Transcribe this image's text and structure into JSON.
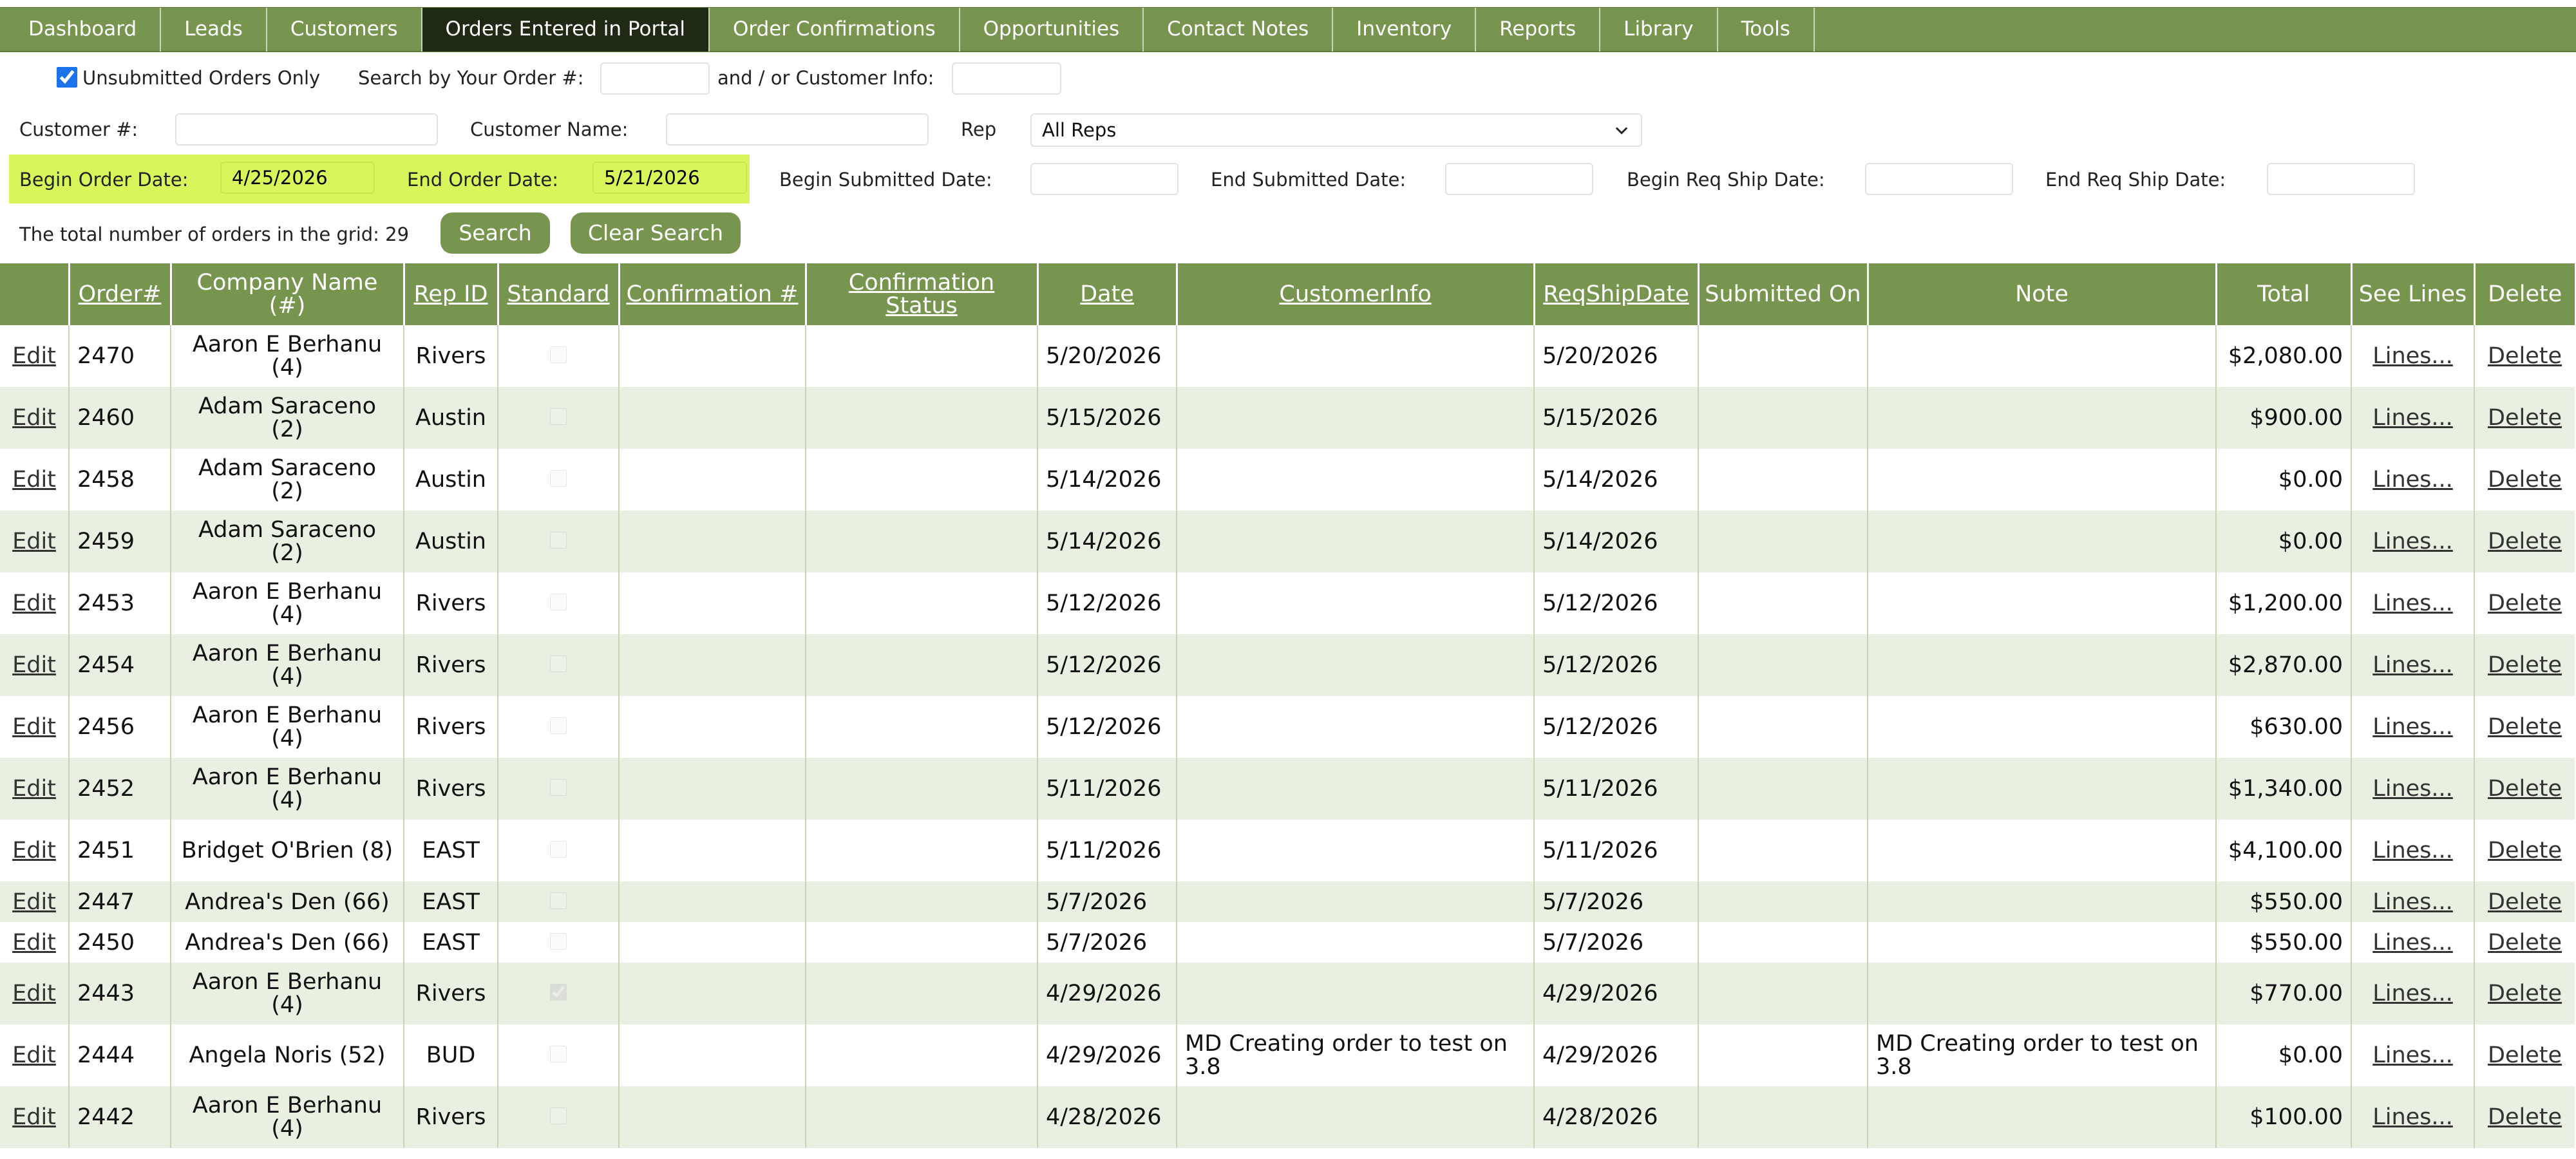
{
  "nav": {
    "tabs": [
      "Dashboard",
      "Leads",
      "Customers",
      "Orders Entered in Portal",
      "Order Confirmations",
      "Opportunities",
      "Contact Notes",
      "Inventory",
      "Reports",
      "Library",
      "Tools"
    ],
    "active_index": 3
  },
  "filters": {
    "unsubmitted_label": "Unsubmitted Orders Only",
    "unsubmitted_checked": true,
    "search_order_label": "Search by Your Order #:",
    "search_order_value": "",
    "customer_info_label": "and / or Customer Info:",
    "customer_info_value": "",
    "customer_num_label": "Customer #:",
    "customer_num_value": "",
    "customer_name_label": "Customer Name:",
    "customer_name_value": "",
    "rep_label": "Rep",
    "rep_selected": "All Reps",
    "begin_order_label": "Begin Order Date:",
    "begin_order_value": "4/25/2026",
    "end_order_label": "End Order Date:",
    "end_order_value": "5/21/2026",
    "begin_submitted_label": "Begin Submitted Date:",
    "begin_submitted_value": "",
    "end_submitted_label": "End Submitted Date:",
    "end_submitted_value": "",
    "begin_ship_label": "Begin Req Ship Date:",
    "begin_ship_value": "",
    "end_ship_label": "End Req Ship Date:",
    "end_ship_value": "",
    "total_label": "The total number of orders in the grid: 29",
    "search_button": "Search",
    "clear_button": "Clear Search"
  },
  "grid": {
    "columns": [
      "",
      "Order#",
      "Company Name (#)",
      "Rep ID",
      "Standard",
      "Confirmation #",
      "Confirmation Status",
      "Date",
      "CustomerInfo",
      "ReqShipDate",
      "Submitted On",
      "Note",
      "Total",
      "See Lines",
      "Delete"
    ],
    "edit_label": "Edit",
    "lines_label": "Lines...",
    "delete_label": "Delete",
    "rows": [
      {
        "order": "2470",
        "company": "Aaron E Berhanu (4)",
        "rep": "Rivers",
        "standard": false,
        "conf": "",
        "status": "",
        "date": "5/20/2026",
        "info": "",
        "ship": "5/20/2026",
        "submitted": "",
        "note": "",
        "total": "$2,080.00",
        "h": 96
      },
      {
        "order": "2460",
        "company": "Adam Saraceno (2)",
        "rep": "Austin",
        "standard": false,
        "conf": "",
        "status": "",
        "date": "5/15/2026",
        "info": "",
        "ship": "5/15/2026",
        "submitted": "",
        "note": "",
        "total": "$900.00",
        "h": 96
      },
      {
        "order": "2458",
        "company": "Adam Saraceno (2)",
        "rep": "Austin",
        "standard": false,
        "conf": "",
        "status": "",
        "date": "5/14/2026",
        "info": "",
        "ship": "5/14/2026",
        "submitted": "",
        "note": "",
        "total": "$0.00",
        "h": 96
      },
      {
        "order": "2459",
        "company": "Adam Saraceno (2)",
        "rep": "Austin",
        "standard": false,
        "conf": "",
        "status": "",
        "date": "5/14/2026",
        "info": "",
        "ship": "5/14/2026",
        "submitted": "",
        "note": "",
        "total": "$0.00",
        "h": 96
      },
      {
        "order": "2453",
        "company": "Aaron E Berhanu (4)",
        "rep": "Rivers",
        "standard": false,
        "conf": "",
        "status": "",
        "date": "5/12/2026",
        "info": "",
        "ship": "5/12/2026",
        "submitted": "",
        "note": "",
        "total": "$1,200.00",
        "h": 96
      },
      {
        "order": "2454",
        "company": "Aaron E Berhanu (4)",
        "rep": "Rivers",
        "standard": false,
        "conf": "",
        "status": "",
        "date": "5/12/2026",
        "info": "",
        "ship": "5/12/2026",
        "submitted": "",
        "note": "",
        "total": "$2,870.00",
        "h": 96
      },
      {
        "order": "2456",
        "company": "Aaron E Berhanu (4)",
        "rep": "Rivers",
        "standard": false,
        "conf": "",
        "status": "",
        "date": "5/12/2026",
        "info": "",
        "ship": "5/12/2026",
        "submitted": "",
        "note": "",
        "total": "$630.00",
        "h": 96
      },
      {
        "order": "2452",
        "company": "Aaron E Berhanu (4)",
        "rep": "Rivers",
        "standard": false,
        "conf": "",
        "status": "",
        "date": "5/11/2026",
        "info": "",
        "ship": "5/11/2026",
        "submitted": "",
        "note": "",
        "total": "$1,340.00",
        "h": 96
      },
      {
        "order": "2451",
        "company": "Bridget O'Brien (8)",
        "rep": "EAST",
        "standard": false,
        "conf": "",
        "status": "",
        "date": "5/11/2026",
        "info": "",
        "ship": "5/11/2026",
        "submitted": "",
        "note": "",
        "total": "$4,100.00",
        "h": 96
      },
      {
        "order": "2447",
        "company": "Andrea's Den (66)",
        "rep": "EAST",
        "standard": false,
        "conf": "",
        "status": "",
        "date": "5/7/2026",
        "info": "",
        "ship": "5/7/2026",
        "submitted": "",
        "note": "",
        "total": "$550.00",
        "h": 63
      },
      {
        "order": "2450",
        "company": "Andrea's Den (66)",
        "rep": "EAST",
        "standard": false,
        "conf": "",
        "status": "",
        "date": "5/7/2026",
        "info": "",
        "ship": "5/7/2026",
        "submitted": "",
        "note": "",
        "total": "$550.00",
        "h": 63
      },
      {
        "order": "2443",
        "company": "Aaron E Berhanu (4)",
        "rep": "Rivers",
        "standard": true,
        "conf": "",
        "status": "",
        "date": "4/29/2026",
        "info": "",
        "ship": "4/29/2026",
        "submitted": "",
        "note": "",
        "total": "$770.00",
        "h": 96
      },
      {
        "order": "2444",
        "company": "Angela Noris (52)",
        "rep": "BUD",
        "standard": false,
        "conf": "",
        "status": "",
        "date": "4/29/2026",
        "info": "MD Creating order to test on 3.8",
        "ship": "4/29/2026",
        "submitted": "",
        "note": "MD Creating order to test on 3.8",
        "total": "$0.00",
        "h": 96
      },
      {
        "order": "2442",
        "company": "Aaron E Berhanu (4)",
        "rep": "Rivers",
        "standard": false,
        "conf": "",
        "status": "",
        "date": "4/28/2026",
        "info": "",
        "ship": "4/28/2026",
        "submitted": "",
        "note": "",
        "total": "$100.00",
        "h": 96
      }
    ]
  }
}
